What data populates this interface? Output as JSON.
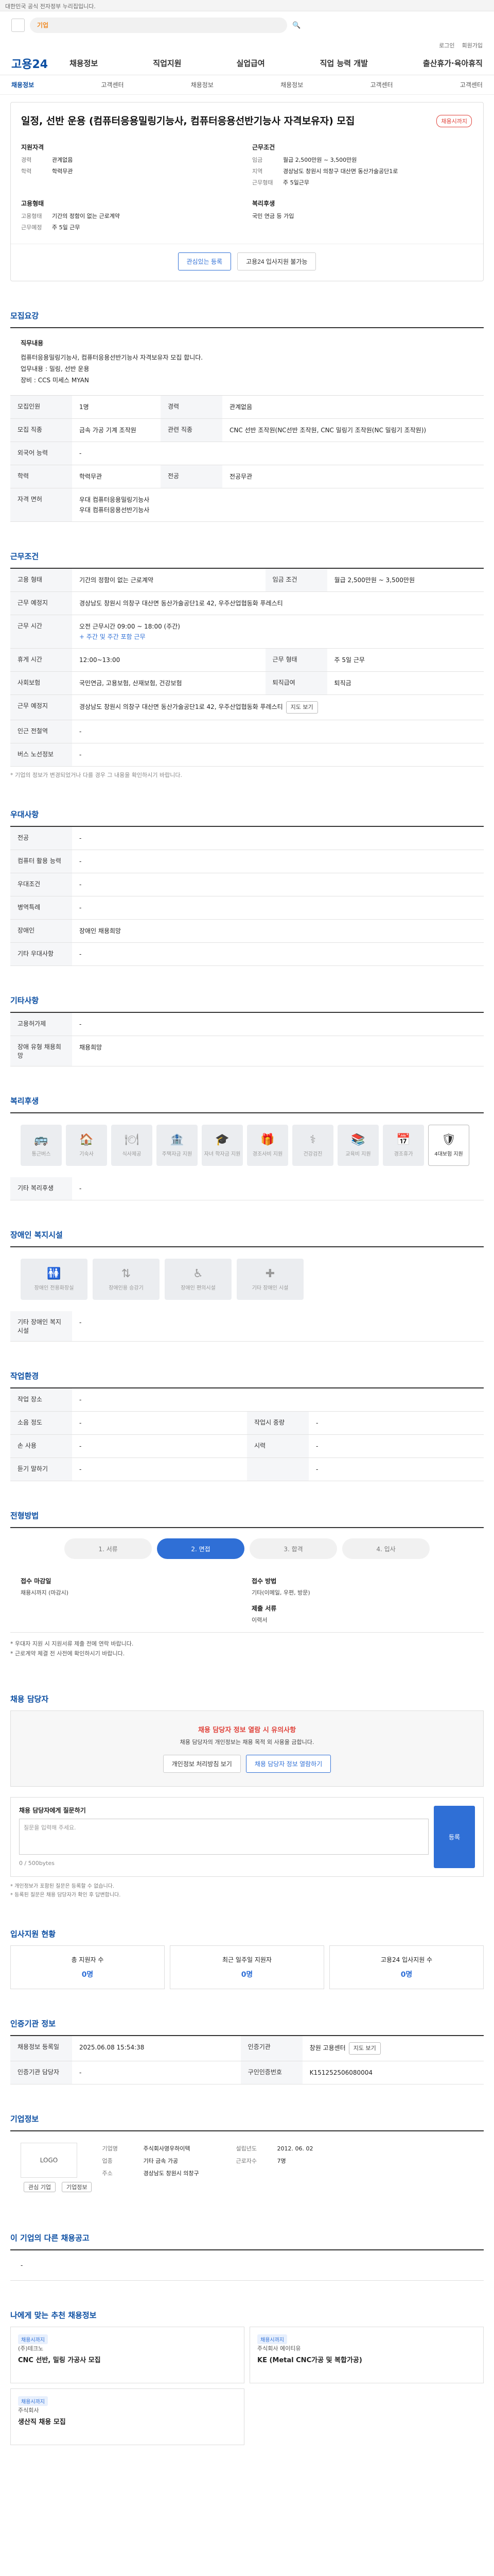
{
  "topbar": {
    "notice": "대한민국 공식 전자정부 누리집입니다."
  },
  "search": {
    "placeholder": "기업"
  },
  "util": {
    "items": [
      "로그인",
      "회원가입"
    ]
  },
  "gnb": {
    "brand": "고용24",
    "menu": [
      "채용정보",
      "직업지원",
      "실업급여",
      "직업 능력 개발",
      "출산휴가·육아휴직"
    ]
  },
  "subnav": {
    "items": [
      "채용정보",
      "고객센터",
      "채용정보",
      "채용정보",
      "고객센터",
      "고객센터"
    ]
  },
  "job": {
    "title": "일정, 선반 운용 (컴퓨터응용밀링기능사, 컴퓨터응용선반기능사 자격보유자) 모집",
    "tag": "채용시까지",
    "left_h": "지원자격",
    "left": [
      {
        "k": "경력",
        "v": "관계없음"
      },
      {
        "k": "학력",
        "v": "학력무관"
      }
    ],
    "right_h": "근무조건",
    "right": [
      {
        "k": "임금",
        "v": "월급 2,500만원 ~ 3,500만원"
      },
      {
        "k": "지역",
        "v": "경상남도 창원시 의창구 대산면 동산가술공단1로"
      },
      {
        "k": "근무형태",
        "v": "주 5일근무"
      }
    ],
    "left2_h": "고용형태",
    "left2": [
      {
        "k": "고용형태",
        "v": "기간의 정함이 없는 근로계약"
      },
      {
        "k": "근무예정",
        "v": "주 5일 근무"
      }
    ],
    "right2_h": "복리후생",
    "right2": [
      {
        "k": "",
        "v": "국민 연금 등 가입"
      }
    ],
    "btn1": "관심있는 등록",
    "btn2": "고용24 입사지원 불가능"
  },
  "recruit": {
    "title": "모집요강",
    "duty_label": "직무내용",
    "duty": "컴퓨터응용밀링기능사, 컴퓨터응용선반기능사 자격보유자 모집 합니다.",
    "duty2": "업무내용 : 밀링, 선반 운용",
    "duty3": "장비 : CCS 미세스 MYAN",
    "rows": [
      {
        "k1": "모집인원",
        "v1": "1명",
        "k2": "경력",
        "v2": "관계없음"
      },
      {
        "k1": "모집 직종",
        "v1": "금속 가공 기계 조작원",
        "k2": "관련 직종",
        "v2": "CNC 선반 조작원(NC선반 조작원, CNC 밀링기 조작원(NC 밀링기 조작원))"
      },
      {
        "k1": "외국어 능력",
        "v1": "-",
        "k2": "",
        "v2": ""
      },
      {
        "k1": "학력",
        "v1": "학력무관",
        "k2": "전공",
        "v2": "전공무관"
      },
      {
        "k1": "자격 면허",
        "v1": "우대 컴퓨터응용밀링기능사",
        "k2": "",
        "v2": ""
      }
    ],
    "license2": "우대 컴퓨터응용선반기능사"
  },
  "cond": {
    "title": "근무조건",
    "rows": [
      {
        "k1": "고용 형태",
        "v1": "기간의 정함이 없는 근로계약",
        "k2": "임금 조건",
        "v2": "월급 2,500만원 ~ 3,500만원"
      }
    ],
    "loc_k": "근무 예정지",
    "loc_v": "경상남도 창원시 의창구 대산면 동산가술공단1로 42, 우주산업협동화 푸레스티",
    "time_k": "근무 시간",
    "time_v": "오전 근무시간 09:00 ~ 18:00 (주간)",
    "time_note": "+ 주간 및 주간 포함 근무",
    "rows2": [
      {
        "k1": "휴게 시간",
        "v1": "12:00~13:00",
        "k2": "근무 형태",
        "v2": "주 5일 근무"
      },
      {
        "k1": "사회보험",
        "v1": "국민연금, 고용보험, 산재보험, 건강보험",
        "k2": "퇴직급여",
        "v2": "퇴직금"
      },
      {
        "k1": "근무 예정지",
        "v1": "경상남도 창원시 의창구 대산면 동산가술공단1로 42, 우주산업협동화 푸레스티",
        "k2": "",
        "v2": ""
      },
      {
        "k1": "인근 전철역",
        "v1": "-",
        "k2": "",
        "v2": ""
      },
      {
        "k1": "버스 노선정보",
        "v1": "-",
        "k2": "",
        "v2": ""
      }
    ],
    "map_btn": "지도 보기",
    "note": "* 기업의 정보가 변경되었거나 다를 경우 그 내용을 확인하시기 바랍니다."
  },
  "pref": {
    "title": "우대사항",
    "rows": [
      {
        "k": "전공",
        "v": "-"
      },
      {
        "k": "컴퓨터 활용 능력",
        "v": "-"
      },
      {
        "k": "우대조건",
        "v": "-"
      },
      {
        "k": "병역특례",
        "v": "-"
      },
      {
        "k": "장애인",
        "v": "장애인 채용희망"
      },
      {
        "k": "기타 우대사항",
        "v": "-"
      }
    ]
  },
  "etc": {
    "title": "기타사항",
    "rows": [
      {
        "k": "고용허가제",
        "v": "-"
      },
      {
        "k": "장애 유형 채용희망",
        "v": "채용희망"
      }
    ]
  },
  "welfare": {
    "title": "복리후생",
    "items": [
      "통근버스",
      "기숙사",
      "식사제공",
      "주택자금 지원",
      "자녀 학자금 지원",
      "경조사비 지원",
      "건강검진",
      "교육비 지원",
      "경조휴가",
      "4대보험 지원"
    ],
    "other_k": "기타 복리후생",
    "other_v": "-"
  },
  "access": {
    "title": "장애인 복지시설",
    "items": [
      "장애인 전용화장실",
      "장애인용 승강기",
      "장애인 편의시설",
      "기타 장애인 시설"
    ],
    "other_k": "기타 장애인 복지시설",
    "other_v": "-"
  },
  "env": {
    "title": "작업환경",
    "rows": [
      {
        "k1": "작업 장소",
        "v1": "-",
        "k2": "",
        "v2": ""
      },
      {
        "k1": "소음 정도",
        "v1": "-",
        "k2": "작업시 중량",
        "v2": "-"
      },
      {
        "k1": "손 사용",
        "v1": "-",
        "k2": "시력",
        "v2": "-"
      },
      {
        "k1": "듣기 말하기",
        "v1": "-",
        "k2": "",
        "v2": "-"
      }
    ]
  },
  "apply": {
    "title": "전형방법",
    "steps": [
      "1. 서류",
      "2. 면접",
      "3. 합격",
      "4. 입사"
    ],
    "col1_h": "접수 마감일",
    "col1_v": "채용시까지 (마감시)",
    "col2_h": "접수 방법",
    "col2_v": "기타(이메일, 우편, 방문)",
    "col3_h": "제출 서류",
    "col3_v": "이력서",
    "notes": "* 우대자 지원 시 지원서류 제출 전에 연락 바랍니다.",
    "notes2": "* 근로계약 체결 전 사전에 확인하시기 바랍니다."
  },
  "contact": {
    "title": "채용 담당자",
    "box_t": "채용 담당자 정보 열람 시 유의사항",
    "box_p": "채용 담당자의 개인정보는 채용 목적 외 사용을 금합니다.",
    "btn1": "개인정보 처리방침 보기",
    "btn2": "채용 담당자 정보 열람하기"
  },
  "question": {
    "label": "채용 담당자에게 질문하기",
    "placeholder": "질문을 입력해 주세요.",
    "btn": "등록",
    "counter": "0 / 500bytes",
    "notes": [
      "* 개인정보가 포함된 질문은 등록할 수 없습니다.",
      "* 등록된 질문은 채용 담당자가 확인 후 답변합니다."
    ]
  },
  "status": {
    "title": "입사지원 현황",
    "cards": [
      {
        "l": "총 지원자 수",
        "n": "0명"
      },
      {
        "l": "최근 일주일 지원자",
        "n": "0명"
      },
      {
        "l": "고용24 입사지원 수",
        "n": "0명"
      }
    ]
  },
  "info": {
    "title": "인증기관 정보",
    "rows": [
      {
        "k1": "채용정보 등록일",
        "v1": "2025.06.08 15:54:38",
        "k2": "인증기관",
        "v2": "창원 고용센터"
      },
      {
        "k1": "인증기관 담당자",
        "v1": "-",
        "k2": "구인인증번호",
        "v2": "K151252506080004"
      }
    ],
    "btn": "지도 보기"
  },
  "company": {
    "title": "기업정보",
    "logo": "LOGO",
    "btn1": "관심 기업",
    "btn2": "기업정보",
    "rows": [
      {
        "k1": "기업명",
        "v1": "주식회사영우하이텍",
        "k2": "설립년도",
        "v2": "2012. 06. 02"
      },
      {
        "k1": "업종",
        "v1": "기타 금속 가공",
        "k2": "근로자수",
        "v2": "7명"
      },
      {
        "k1": "주소",
        "v1": "경상남도 창원시 의창구",
        "k2": "",
        "v2": ""
      }
    ]
  },
  "others": {
    "title": "이 기업의 다른 채용공고",
    "none": "-",
    "rec_title": "나에게 맞는 추천 채용정보",
    "jobs": [
      {
        "badge": "채용시까지",
        "cmp": "(주)테크노",
        "ttl": "CNC 선반, 밀링 가공사 모집"
      },
      {
        "badge": "채용시까지",
        "cmp": "주식회사 에이티유",
        "ttl": "KE (Metal CNC가공 및 복합가공)"
      },
      {
        "badge": "채용시까지",
        "cmp": "주식회사",
        "ttl": "생산직 채용 모집"
      }
    ]
  }
}
